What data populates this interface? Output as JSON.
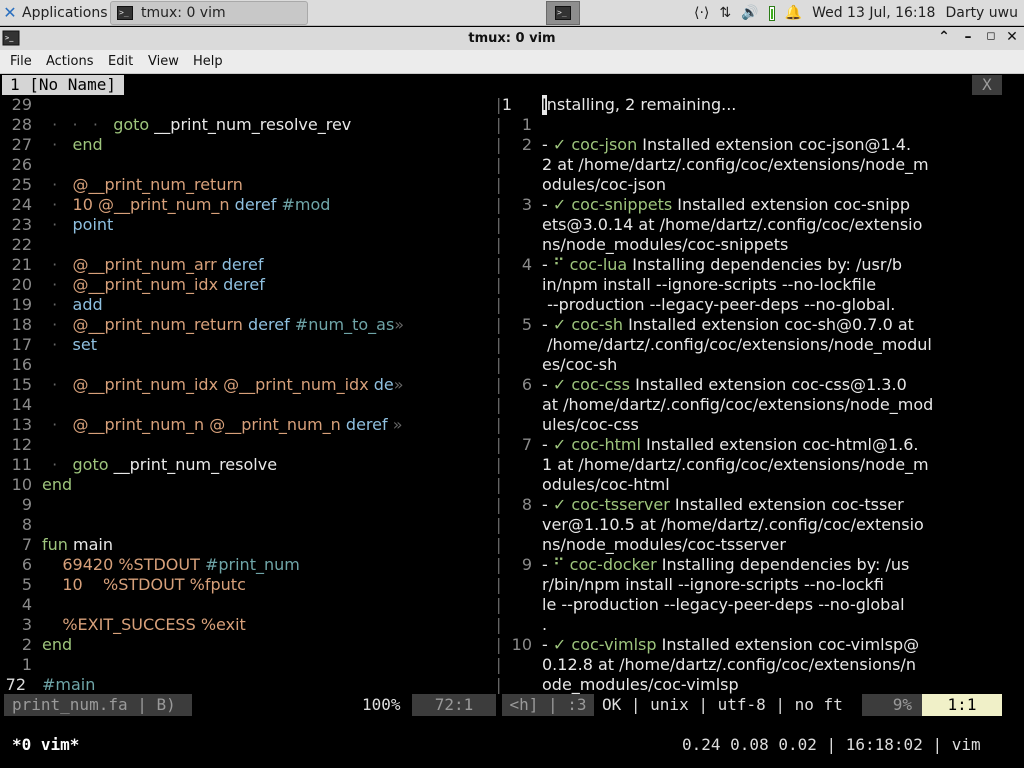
{
  "panel": {
    "apps_label": "Applications",
    "task_label": "tmux: 0 vim",
    "tray_net": "⟨·⟩",
    "tray_arrows": "⇅",
    "tray_volume": "🔊",
    "tray_bell": "🔔",
    "clock": "Wed 13 Jul, 16:18",
    "user": "Darty uwu"
  },
  "window": {
    "title": "tmux: 0 vim",
    "menu": [
      "File",
      "Actions",
      "Edit",
      "View",
      "Help"
    ]
  },
  "vim": {
    "tab_label": "1 [No Name]",
    "tab_close": "X",
    "left_lines": [
      {
        "n": "29",
        "parts": []
      },
      {
        "n": "28",
        "parts": [
          [
            "cd",
            "  ·   ·   ·   "
          ],
          [
            "ck",
            "goto"
          ],
          [
            "cw",
            " __print_num_resolve_rev"
          ]
        ]
      },
      {
        "n": "27",
        "parts": [
          [
            "cd",
            "  ·   "
          ],
          [
            "ck",
            "end"
          ]
        ]
      },
      {
        "n": "26",
        "parts": []
      },
      {
        "n": "25",
        "parts": [
          [
            "cd",
            "  ·   "
          ],
          [
            "co",
            "@__print_num_return"
          ]
        ]
      },
      {
        "n": "24",
        "parts": [
          [
            "cd",
            "  ·   "
          ],
          [
            "co",
            "10"
          ],
          [
            "cw",
            " "
          ],
          [
            "co",
            "@__print_num_n"
          ],
          [
            "cw",
            " "
          ],
          [
            "cb",
            "deref"
          ],
          [
            "cw",
            " "
          ],
          [
            "ct",
            "#mod"
          ]
        ]
      },
      {
        "n": "23",
        "parts": [
          [
            "cd",
            "  ·   "
          ],
          [
            "cb",
            "point"
          ]
        ]
      },
      {
        "n": "22",
        "parts": []
      },
      {
        "n": "21",
        "parts": [
          [
            "cd",
            "  ·   "
          ],
          [
            "co",
            "@__print_num_arr"
          ],
          [
            "cw",
            " "
          ],
          [
            "cb",
            "deref"
          ]
        ]
      },
      {
        "n": "20",
        "parts": [
          [
            "cd",
            "  ·   "
          ],
          [
            "co",
            "@__print_num_idx"
          ],
          [
            "cw",
            " "
          ],
          [
            "cb",
            "deref"
          ]
        ]
      },
      {
        "n": "19",
        "parts": [
          [
            "cd",
            "  ·   "
          ],
          [
            "cb",
            "add"
          ]
        ]
      },
      {
        "n": "18",
        "parts": [
          [
            "cd",
            "  ·   "
          ],
          [
            "co",
            "@__print_num_return"
          ],
          [
            "cw",
            " "
          ],
          [
            "cb",
            "deref"
          ],
          [
            "cw",
            " "
          ],
          [
            "ct",
            "#num_to_as"
          ],
          [
            "cd",
            "»"
          ]
        ]
      },
      {
        "n": "17",
        "parts": [
          [
            "cd",
            "  ·   "
          ],
          [
            "cb",
            "set"
          ]
        ]
      },
      {
        "n": "16",
        "parts": []
      },
      {
        "n": "15",
        "parts": [
          [
            "cd",
            "  ·   "
          ],
          [
            "co",
            "@__print_num_idx"
          ],
          [
            "cw",
            " "
          ],
          [
            "co",
            "@__print_num_idx"
          ],
          [
            "cw",
            " "
          ],
          [
            "cb",
            "de"
          ],
          [
            "cd",
            "»"
          ]
        ]
      },
      {
        "n": "14",
        "parts": []
      },
      {
        "n": "13",
        "parts": [
          [
            "cd",
            "  ·   "
          ],
          [
            "co",
            "@__print_num_n"
          ],
          [
            "cw",
            " "
          ],
          [
            "co",
            "@__print_num_n"
          ],
          [
            "cw",
            " "
          ],
          [
            "cb",
            "deref"
          ],
          [
            "cw",
            " "
          ],
          [
            "cd",
            "»"
          ]
        ]
      },
      {
        "n": "12",
        "parts": []
      },
      {
        "n": "11",
        "parts": [
          [
            "cd",
            "  ·   "
          ],
          [
            "ck",
            "goto"
          ],
          [
            "cw",
            " __print_num_resolve"
          ]
        ]
      },
      {
        "n": "10",
        "parts": [
          [
            "ck",
            "end"
          ]
        ]
      },
      {
        "n": "9",
        "parts": []
      },
      {
        "n": "8",
        "parts": []
      },
      {
        "n": "7",
        "parts": [
          [
            "ck",
            "fun"
          ],
          [
            "cw",
            " main"
          ]
        ]
      },
      {
        "n": "6",
        "parts": [
          [
            "co",
            "    69420"
          ],
          [
            "cw",
            " "
          ],
          [
            "co",
            "%STDOUT"
          ],
          [
            "cw",
            " "
          ],
          [
            "ct",
            "#print_num"
          ]
        ]
      },
      {
        "n": "5",
        "parts": [
          [
            "co",
            "    10"
          ],
          [
            "cw",
            "    "
          ],
          [
            "co",
            "%STDOUT"
          ],
          [
            "cw",
            " "
          ],
          [
            "co",
            "%fputc"
          ]
        ]
      },
      {
        "n": "4",
        "parts": []
      },
      {
        "n": "3",
        "parts": [
          [
            "co",
            "    %EXIT_SUCCESS"
          ],
          [
            "cw",
            " "
          ],
          [
            "co",
            "%exit"
          ]
        ]
      },
      {
        "n": "2",
        "parts": [
          [
            "ck",
            "end"
          ]
        ]
      },
      {
        "n": "1",
        "parts": []
      },
      {
        "n": "72",
        "parts": [
          [
            "ct",
            "#main"
          ]
        ]
      }
    ],
    "right_first_rest": "nstalling, 2 remaining...",
    "right_first_cursor": "I",
    "right_lines": [
      {
        "n": "1",
        "t": ""
      },
      {
        "n": "2",
        "t": [
          [
            "cw",
            "- "
          ],
          [
            "cg",
            "✓ coc-json"
          ],
          [
            "cw",
            " Installed extension coc-json@1.4."
          ]
        ]
      },
      {
        "n": "",
        "t": [
          [
            "cw",
            "2 at /home/dartz/.config/coc/extensions/node_m"
          ]
        ]
      },
      {
        "n": "",
        "t": [
          [
            "cw",
            "odules/coc-json"
          ]
        ]
      },
      {
        "n": "3",
        "t": [
          [
            "cw",
            "- "
          ],
          [
            "cg",
            "✓ coc-snippets"
          ],
          [
            "cw",
            " Installed extension coc-snipp"
          ]
        ]
      },
      {
        "n": "",
        "t": [
          [
            "cw",
            "ets@3.0.14 at /home/dartz/.config/coc/extensio"
          ]
        ]
      },
      {
        "n": "",
        "t": [
          [
            "cw",
            "ns/node_modules/coc-snippets"
          ]
        ]
      },
      {
        "n": "4",
        "t": [
          [
            "cw",
            "- "
          ],
          [
            "cg",
            "⠋ coc-lua"
          ],
          [
            "cw",
            " Installing dependencies by: /usr/b"
          ]
        ]
      },
      {
        "n": "",
        "t": [
          [
            "cw",
            "in/npm install --ignore-scripts --no-lockfile"
          ]
        ]
      },
      {
        "n": "",
        "t": [
          [
            "cw",
            " --production --legacy-peer-deps --no-global."
          ]
        ]
      },
      {
        "n": "5",
        "t": [
          [
            "cw",
            "- "
          ],
          [
            "cg",
            "✓ coc-sh"
          ],
          [
            "cw",
            " Installed extension coc-sh@0.7.0 at"
          ]
        ]
      },
      {
        "n": "",
        "t": [
          [
            "cw",
            " /home/dartz/.config/coc/extensions/node_modul"
          ]
        ]
      },
      {
        "n": "",
        "t": [
          [
            "cw",
            "es/coc-sh"
          ]
        ]
      },
      {
        "n": "6",
        "t": [
          [
            "cw",
            "- "
          ],
          [
            "cg",
            "✓ coc-css"
          ],
          [
            "cw",
            " Installed extension coc-css@1.3.0"
          ]
        ]
      },
      {
        "n": "",
        "t": [
          [
            "cw",
            "at /home/dartz/.config/coc/extensions/node_mod"
          ]
        ]
      },
      {
        "n": "",
        "t": [
          [
            "cw",
            "ules/coc-css"
          ]
        ]
      },
      {
        "n": "7",
        "t": [
          [
            "cw",
            "- "
          ],
          [
            "cg",
            "✓ coc-html"
          ],
          [
            "cw",
            " Installed extension coc-html@1.6."
          ]
        ]
      },
      {
        "n": "",
        "t": [
          [
            "cw",
            "1 at /home/dartz/.config/coc/extensions/node_m"
          ]
        ]
      },
      {
        "n": "",
        "t": [
          [
            "cw",
            "odules/coc-html"
          ]
        ]
      },
      {
        "n": "8",
        "t": [
          [
            "cw",
            "- "
          ],
          [
            "cg",
            "✓ coc-tsserver"
          ],
          [
            "cw",
            " Installed extension coc-tsser"
          ]
        ]
      },
      {
        "n": "",
        "t": [
          [
            "cw",
            "ver@1.10.5 at /home/dartz/.config/coc/extensio"
          ]
        ]
      },
      {
        "n": "",
        "t": [
          [
            "cw",
            "ns/node_modules/coc-tsserver"
          ]
        ]
      },
      {
        "n": "9",
        "t": [
          [
            "cw",
            "- "
          ],
          [
            "cg",
            "⠋ coc-docker"
          ],
          [
            "cw",
            " Installing dependencies by: /us"
          ]
        ]
      },
      {
        "n": "",
        "t": [
          [
            "cw",
            "r/bin/npm install --ignore-scripts --no-lockfi"
          ]
        ]
      },
      {
        "n": "",
        "t": [
          [
            "cw",
            "le --production --legacy-peer-deps --no-global"
          ]
        ]
      },
      {
        "n": "",
        "t": [
          [
            "cw",
            "."
          ]
        ]
      },
      {
        "n": "10",
        "t": [
          [
            "cw",
            "- "
          ],
          [
            "cg",
            "✓ coc-vimlsp"
          ],
          [
            "cw",
            " Installed extension coc-vimlsp@"
          ]
        ]
      },
      {
        "n": "",
        "t": [
          [
            "cw",
            "0.12.8 at /home/dartz/.config/coc/extensions/n"
          ]
        ]
      },
      {
        "n": "",
        "t": [
          [
            "cw",
            "ode_modules/coc-vimlsp"
          ]
        ]
      }
    ],
    "status": {
      "left_file": "print_num.fa | B)",
      "left_pct": "100%",
      "left_pos": "72:1",
      "right_mode": "<h] | :3",
      "right_info": "OK | unix | utf-8 | no ft",
      "right_pct": "9%",
      "right_pos": "1:1"
    }
  },
  "tmux": {
    "window": "*0 vim*",
    "right": "0.24 0.08 0.02 | 16:18:02 | vim"
  }
}
